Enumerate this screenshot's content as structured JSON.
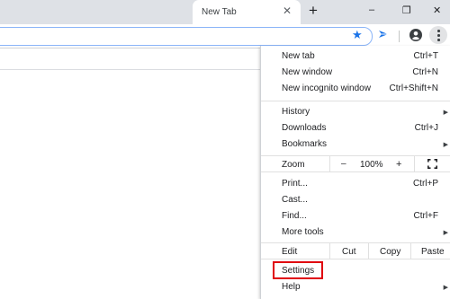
{
  "tab": {
    "title": "New Tab",
    "close": "✕"
  },
  "tabstrip": {
    "new_tab": "+"
  },
  "window": {
    "minimize": "–",
    "restore": "❐",
    "close": "✕"
  },
  "toolbar": {
    "star": "★"
  },
  "menu": {
    "new_tab": "New tab",
    "new_tab_sc": "Ctrl+T",
    "new_window": "New window",
    "new_window_sc": "Ctrl+N",
    "new_incognito": "New incognito window",
    "new_incognito_sc": "Ctrl+Shift+N",
    "history": "History",
    "downloads": "Downloads",
    "downloads_sc": "Ctrl+J",
    "bookmarks": "Bookmarks",
    "zoom": "Zoom",
    "zoom_minus": "–",
    "zoom_level": "100%",
    "zoom_plus": "+",
    "print": "Print...",
    "print_sc": "Ctrl+P",
    "cast": "Cast...",
    "find": "Find...",
    "find_sc": "Ctrl+F",
    "more_tools": "More tools",
    "edit": "Edit",
    "cut": "Cut",
    "copy": "Copy",
    "paste": "Paste",
    "settings": "Settings",
    "help": "Help",
    "submenu_arrow": "▶"
  },
  "colors": {
    "highlight": "#e0000c",
    "accent": "#1a73e8"
  }
}
